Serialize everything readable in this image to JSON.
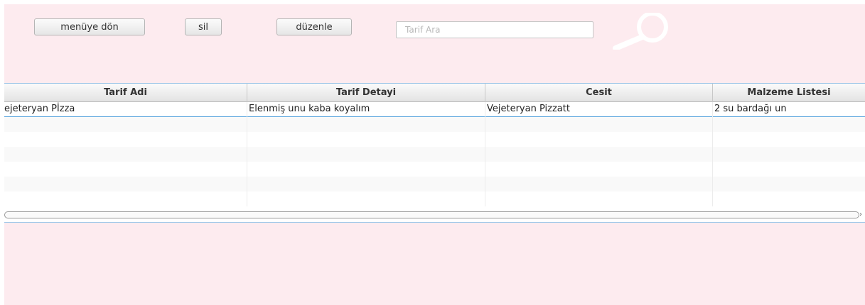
{
  "toolbar": {
    "menu_label": "menüye dön",
    "delete_label": "sil",
    "edit_label": "düzenle",
    "search_placeholder": "Tarif Ara",
    "search_value": ""
  },
  "table": {
    "columns": [
      "Tarif Adi",
      "Tarif Detayi",
      "Cesit",
      "Malzeme Listesi"
    ],
    "rows": [
      [
        "ejeteryan Pİzza",
        "Elenmiş unu kaba koyalım",
        "Vejeteryan Pizzatt",
        "2 su bardağı un"
      ]
    ]
  },
  "icons": {
    "search": "magnifier-icon",
    "scroll_right": "chevron-right-icon"
  },
  "colors": {
    "background": "#fdebef",
    "selection_border": "#5fa8df",
    "header": "#e3e3e3"
  }
}
